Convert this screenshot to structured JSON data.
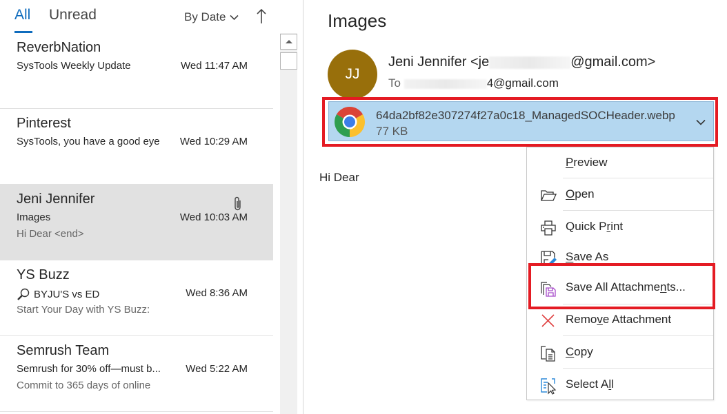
{
  "list": {
    "tabs": [
      {
        "label": "All",
        "active": true
      },
      {
        "label": "Unread",
        "active": false
      }
    ],
    "sort": {
      "label": "By Date",
      "direction_icon": "arrow-up-icon"
    },
    "messages": [
      {
        "sender": "ReverbNation",
        "subject": "SysTools Weekly Update",
        "time": "Wed 11:47 AM",
        "preview": "",
        "selected": false,
        "has_attachment": false
      },
      {
        "sender": "Pinterest",
        "subject": "SysTools, you have a good eye",
        "time": "Wed 10:29 AM",
        "preview": "",
        "selected": false,
        "has_attachment": false
      },
      {
        "sender": "Jeni Jennifer",
        "subject": "Images",
        "time": "Wed 10:03 AM",
        "preview": "Hi Dear <end>",
        "selected": true,
        "has_attachment": true
      },
      {
        "sender": "YS Buzz",
        "subject": "BYJU'S vs ED",
        "subject_icon": "magnifier-icon",
        "time": "Wed 8:36 AM",
        "preview": "Start Your Day with YS Buzz:",
        "selected": false,
        "has_attachment": false
      },
      {
        "sender": "Semrush Team",
        "subject": "Semrush for 30% off—must b...",
        "time": "Wed 5:22 AM",
        "preview": "Commit to 365 days of online",
        "selected": false,
        "has_attachment": false
      }
    ]
  },
  "reading": {
    "subject": "Images",
    "avatar_initials": "JJ",
    "avatar_color": "#986f0b",
    "from_name": "Jeni Jennifer <je",
    "from_domain": "@gmail.com>",
    "to_label": "To",
    "to_domain": "4@gmail.com",
    "attachment": {
      "name": "64da2bf82e307274f27a0c18_ManagedSOCHeader.webp",
      "size": "77 KB",
      "icon": "chrome-icon"
    },
    "body": "Hi Dear"
  },
  "context_menu": {
    "items": [
      {
        "pre": "",
        "key": "P",
        "post": "review",
        "icon": ""
      },
      {
        "pre": "",
        "key": "O",
        "post": "pen",
        "icon": "folder-open-icon"
      },
      {
        "pre": "Quick P",
        "key": "r",
        "post": "int",
        "icon": "printer-icon"
      },
      {
        "pre": "",
        "key": "S",
        "post": "ave As",
        "icon": "save-as-icon"
      },
      {
        "pre": "Save All Attachme",
        "key": "n",
        "post": "ts...",
        "icon": "save-all-icon"
      },
      {
        "pre": "Remo",
        "key": "v",
        "post": "e Attachment",
        "icon": "remove-icon"
      },
      {
        "pre": "",
        "key": "C",
        "post": "opy",
        "icon": "copy-icon"
      },
      {
        "pre": "Select A",
        "key": "l",
        "post": "l",
        "icon": "select-all-icon"
      }
    ]
  },
  "colors": {
    "accent": "#0f6cbd",
    "highlight_box": "#e41b23",
    "attachment_bg": "#b4d7f0",
    "selected_row": "#e1e1e1"
  }
}
